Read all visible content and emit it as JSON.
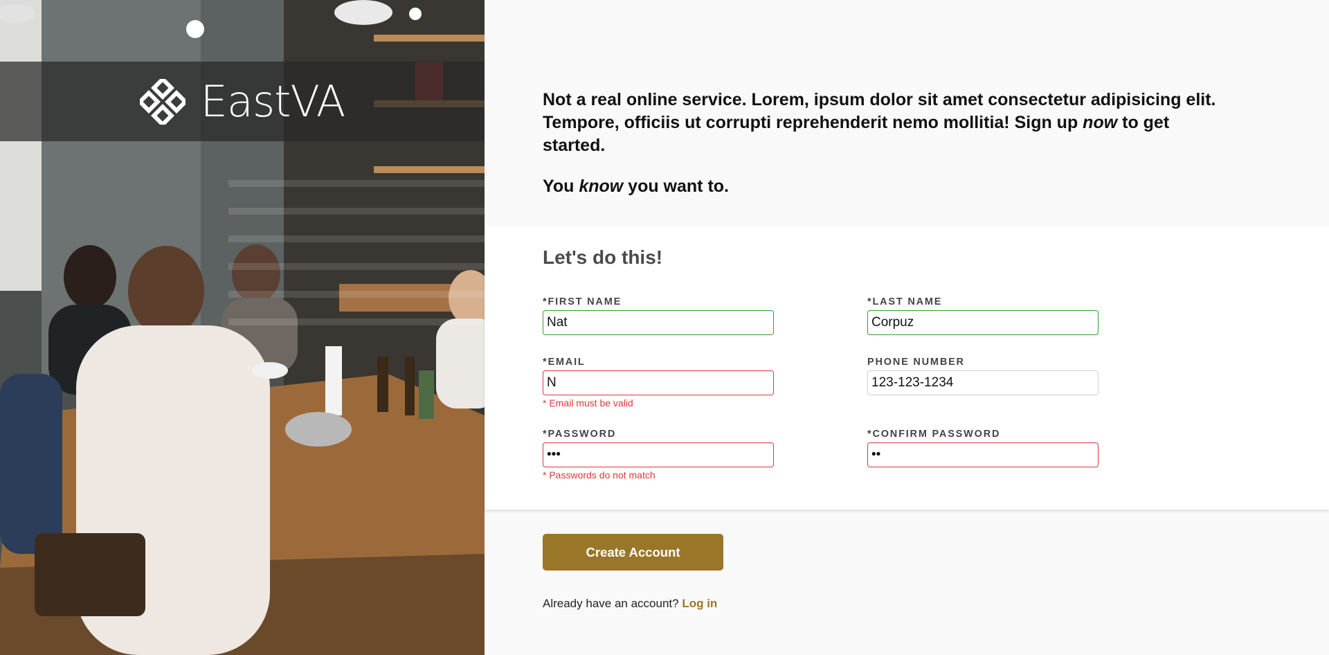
{
  "brand": {
    "name": "EastVA",
    "logo_icon": "diamond-knot-icon"
  },
  "intro": {
    "line1_start": "Not a real online service. Lorem, ipsum dolor sit amet consectetur adipisicing elit. Tempore, officiis ut corrupti reprehenderit nemo mollitia! Sign up ",
    "line1_emph": "now",
    "line1_end": " to get started.",
    "line2_start": "You ",
    "line2_emph": "know",
    "line2_end": " you want to."
  },
  "form": {
    "title": "Let's do this!",
    "first_name": {
      "label": "*FIRST NAME",
      "value": "Nat",
      "state": "valid"
    },
    "last_name": {
      "label": "*LAST NAME",
      "value": "Corpuz",
      "state": "valid"
    },
    "email": {
      "label": "*EMAIL",
      "value": "N",
      "state": "invalid",
      "error": "* Email must be valid"
    },
    "phone": {
      "label": "PHONE NUMBER",
      "value": "123-123-1234",
      "state": "neutral"
    },
    "password": {
      "label": "*PASSWORD",
      "value": "•••",
      "state": "invalid",
      "error": "* Passwords do not match"
    },
    "confirm_password": {
      "label": "*CONFIRM PASSWORD",
      "value": "••",
      "state": "invalid"
    }
  },
  "actions": {
    "create_account": "Create Account",
    "have_account_text": "Already have an account? ",
    "login_link": "Log in"
  },
  "colors": {
    "accent": "#9a7628",
    "valid": "#2ea22e",
    "invalid": "#e0353a"
  }
}
